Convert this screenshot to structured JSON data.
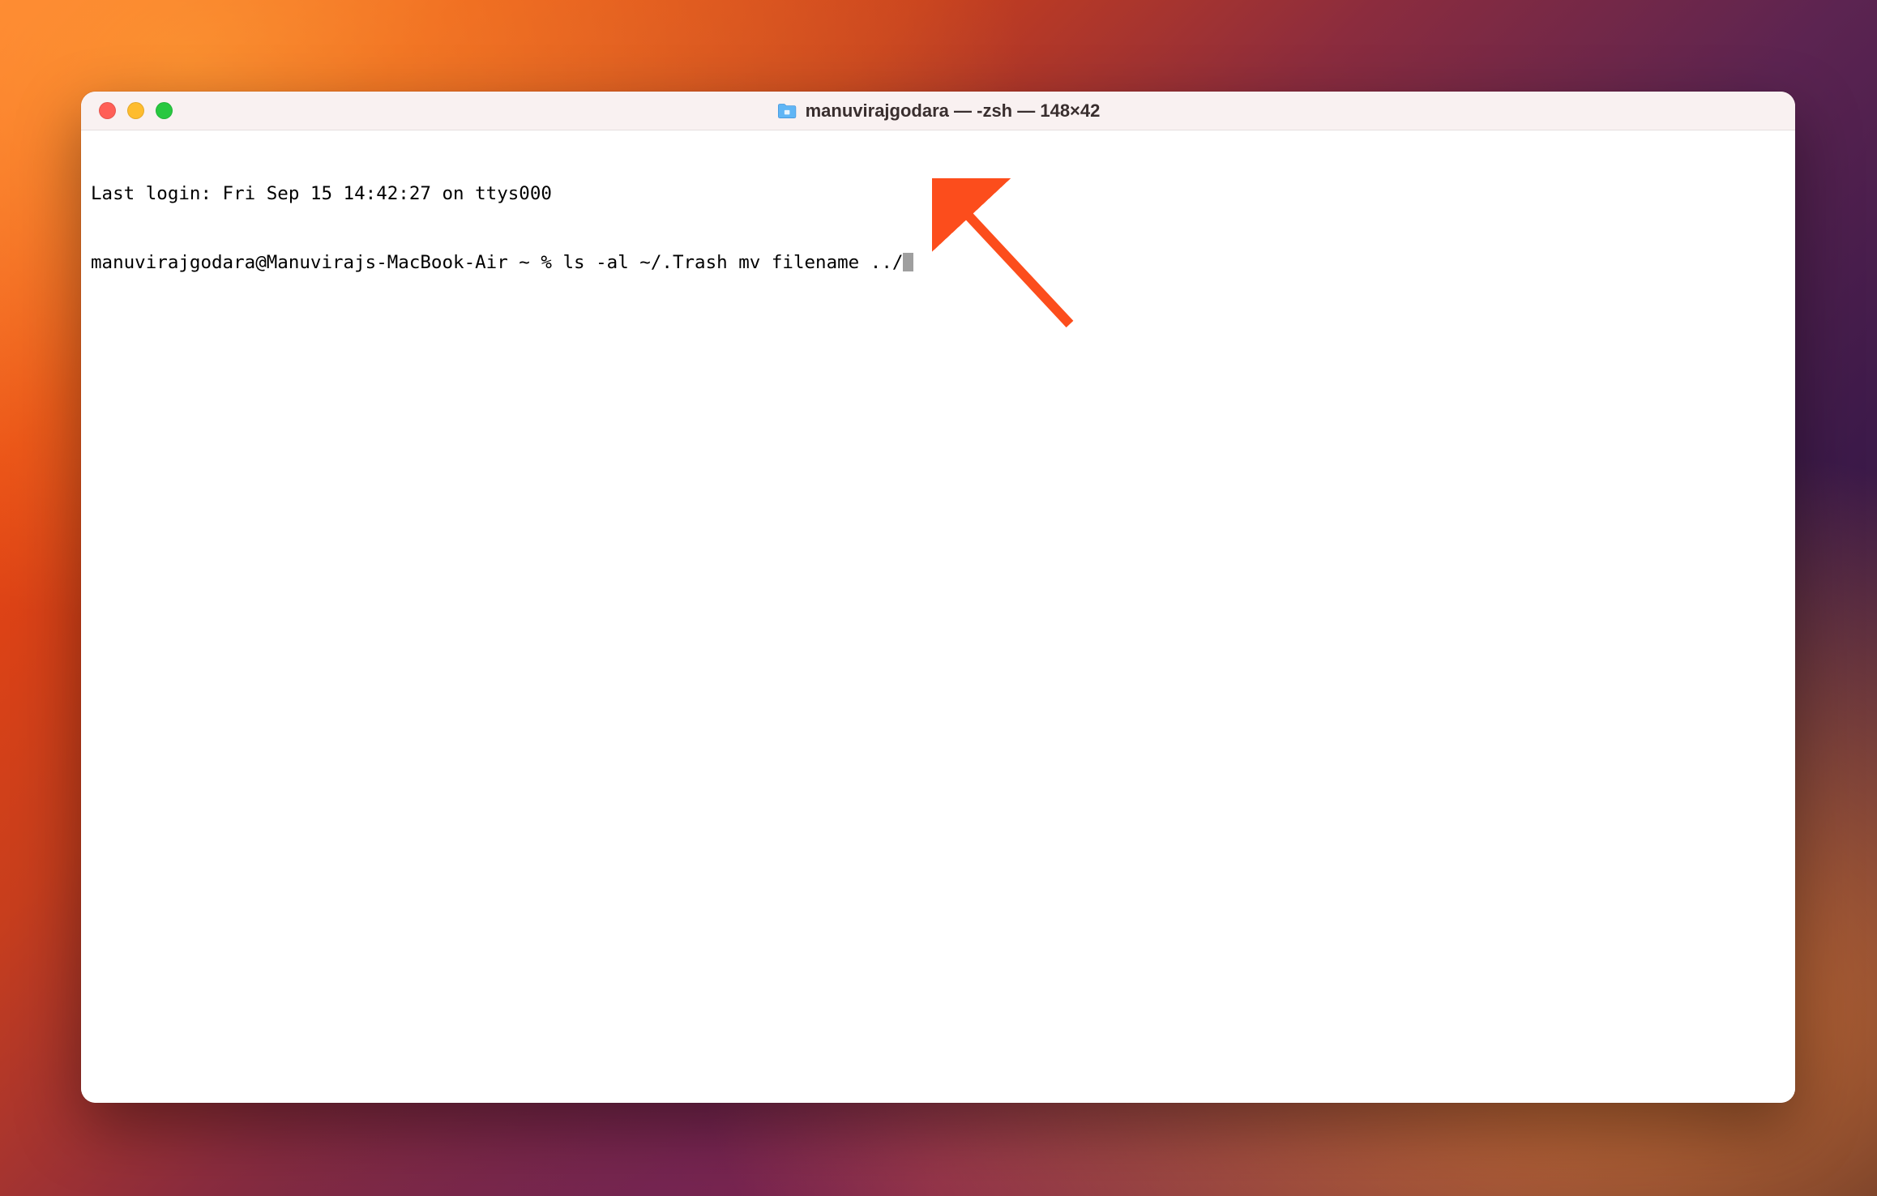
{
  "window": {
    "title": "manuvirajgodara — -zsh — 148×42"
  },
  "terminal": {
    "last_login": "Last login: Fri Sep 15 14:42:27 on ttys000",
    "prompt": "manuvirajgodara@Manuvirajs-MacBook-Air ~ % ",
    "command": "ls -al ~/.Trash mv filename ../"
  },
  "colors": {
    "close_button": "#ff5f57",
    "minimize_button": "#febc2e",
    "maximize_button": "#28c840",
    "arrow": "#fc4d1c"
  }
}
